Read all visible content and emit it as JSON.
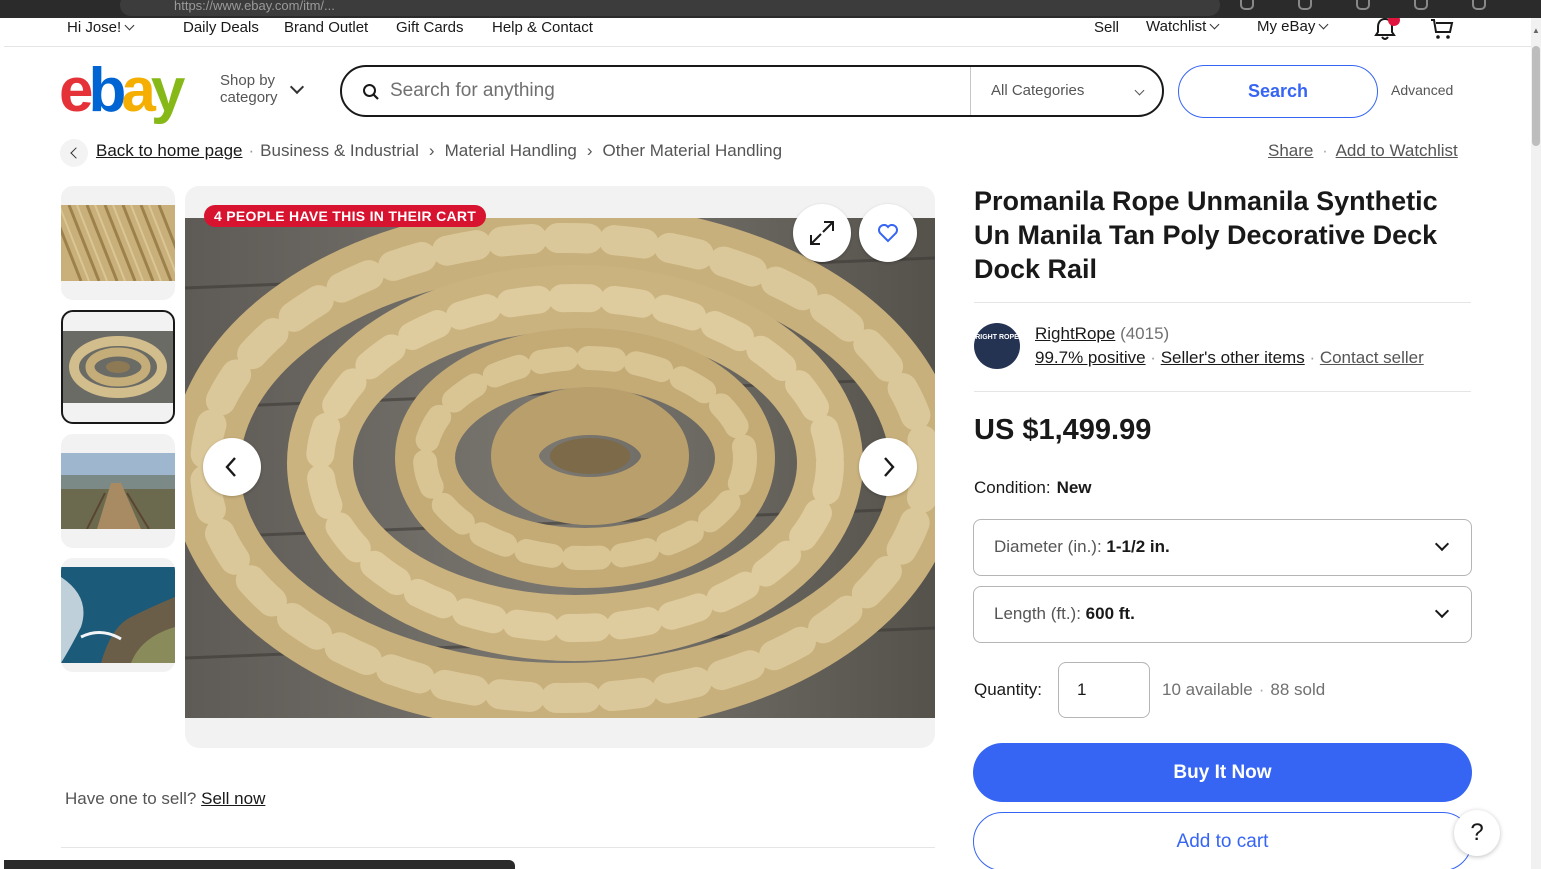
{
  "browser": {
    "url": "https://www.ebay.com/itm/..."
  },
  "topnav": {
    "greeting": "Hi Jose!",
    "links": [
      "Daily Deals",
      "Brand Outlet",
      "Gift Cards",
      "Help & Contact"
    ],
    "sell": "Sell",
    "watchlist": "Watchlist",
    "my_ebay": "My eBay"
  },
  "header": {
    "logo": "ebay",
    "shop_by": "Shop by category",
    "search_placeholder": "Search for anything",
    "category": "All Categories",
    "search_button": "Search",
    "advanced": "Advanced"
  },
  "breadcrumb": {
    "back": "Back to home page",
    "items": [
      "Business & Industrial",
      "Material Handling",
      "Other Material Handling"
    ],
    "share": "Share",
    "watchlist": "Add to Watchlist"
  },
  "gallery": {
    "cart_badge": "4 PEOPLE HAVE THIS IN THEIR CART",
    "thumbnails": [
      "rope-texture",
      "rope-coil",
      "coastal-walkway",
      "coast-cliffs"
    ],
    "selected_thumbnail_index": 1
  },
  "sell_prompt": {
    "text": "Have one to sell?",
    "link": "Sell now"
  },
  "product": {
    "title": "Promanila Rope Unmanila Synthetic Un Manila Tan Poly Decorative Deck Dock Rail",
    "seller": {
      "avatar_text": "RIGHT ROPE",
      "name": "RightRope",
      "feedback_count": "(4015)",
      "positive": "99.7% positive",
      "other_items": "Seller's other items",
      "contact": "Contact seller"
    },
    "price": "US $1,499.99",
    "condition_label": "Condition:",
    "condition_value": "New",
    "diameter_label": "Diameter (in.):",
    "diameter_value": "1-1/2 in.",
    "length_label": "Length (ft.):",
    "length_value": "600 ft.",
    "quantity_label": "Quantity:",
    "quantity_value": "1",
    "available": "10 available",
    "sold": "88 sold",
    "buy_now": "Buy It Now",
    "add_to_cart": "Add to cart",
    "help": "?"
  },
  "colors": {
    "primary_blue": "#3665f3",
    "badge_red": "#d7132f",
    "text": "#191919",
    "rope_tan": "#cdb88a"
  }
}
